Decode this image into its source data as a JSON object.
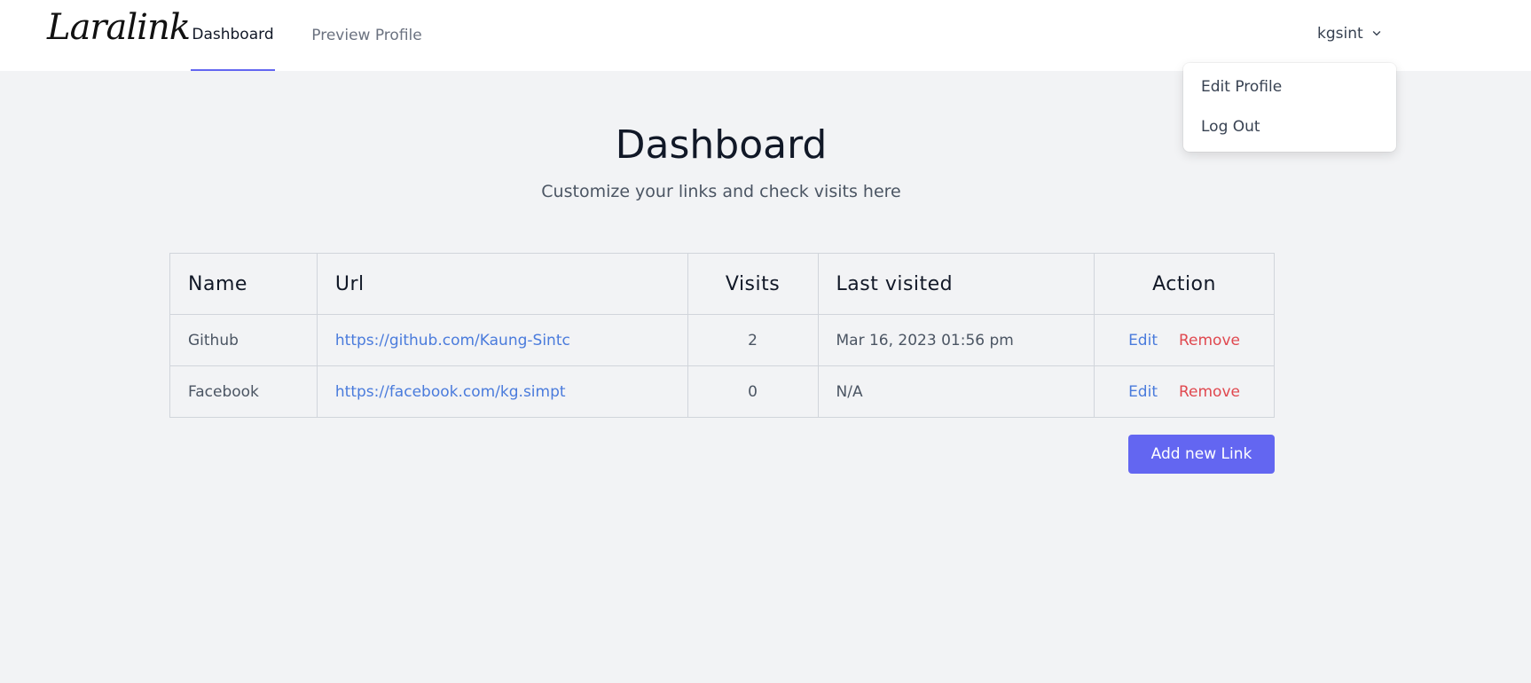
{
  "nav": {
    "logo": "Laralink",
    "links": [
      {
        "label": "Dashboard",
        "active": true
      },
      {
        "label": "Preview Profile",
        "active": false
      }
    ],
    "user": "kgsint",
    "accent": "#6366f1"
  },
  "dropdown": {
    "items": [
      {
        "label": "Edit Profile"
      },
      {
        "label": "Log Out"
      }
    ]
  },
  "header": {
    "title": "Dashboard",
    "subtitle": "Customize your links and check visits here"
  },
  "table": {
    "columns": [
      "Name",
      "Url",
      "Visits",
      "Last visited",
      "Action"
    ],
    "rows": [
      {
        "name": "Github",
        "url": "https://github.com/Kaung-Sintc",
        "visits": "2",
        "last_visited": "Mar 16, 2023 01:56 pm",
        "edit": "Edit",
        "remove": "Remove"
      },
      {
        "name": "Facebook",
        "url": "https://facebook.com/kg.simpt",
        "visits": "0",
        "last_visited": "N/A",
        "edit": "Edit",
        "remove": "Remove"
      }
    ]
  },
  "actions": {
    "add_link": "Add new Link"
  },
  "colors": {
    "link": "#4a7bdc",
    "danger": "#e0484f",
    "background": "#f2f3f5"
  }
}
